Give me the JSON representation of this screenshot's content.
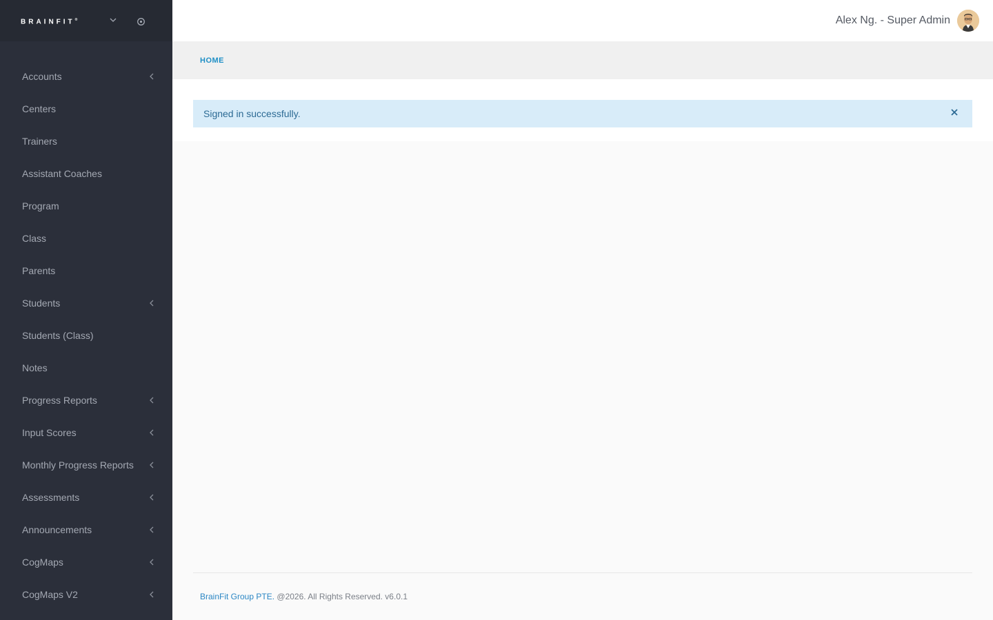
{
  "brand": {
    "logo_text": "BRAINFIT",
    "logo_mark": "®"
  },
  "sidebar": {
    "items": [
      {
        "label": "Accounts",
        "has_submenu": true
      },
      {
        "label": "Centers",
        "has_submenu": false
      },
      {
        "label": "Trainers",
        "has_submenu": false
      },
      {
        "label": "Assistant Coaches",
        "has_submenu": false
      },
      {
        "label": "Program",
        "has_submenu": false
      },
      {
        "label": "Class",
        "has_submenu": false
      },
      {
        "label": "Parents",
        "has_submenu": false
      },
      {
        "label": "Students",
        "has_submenu": true
      },
      {
        "label": "Students (Class)",
        "has_submenu": false
      },
      {
        "label": "Notes",
        "has_submenu": false
      },
      {
        "label": "Progress Reports",
        "has_submenu": true
      },
      {
        "label": "Input Scores",
        "has_submenu": true
      },
      {
        "label": "Monthly Progress Reports",
        "has_submenu": true
      },
      {
        "label": "Assessments",
        "has_submenu": true
      },
      {
        "label": "Announcements",
        "has_submenu": true
      },
      {
        "label": "CogMaps",
        "has_submenu": true
      },
      {
        "label": "CogMaps V2",
        "has_submenu": true
      }
    ]
  },
  "header": {
    "user_label": "Alex Ng. - Super Admin"
  },
  "breadcrumb": {
    "home": "HOME"
  },
  "alert": {
    "message": "Signed in successfully.",
    "close_glyph": "×"
  },
  "footer": {
    "company_link": "BrainFit Group PTE.",
    "rest": " @2026. All Rights Reserved. v6.0.1"
  },
  "colors": {
    "sidebar_bg": "#2b2f3a",
    "sidebar_brand_bg": "#262a33",
    "sidebar_text": "#a4a9b3",
    "accent": "#1e8fc6",
    "alert_bg": "#d8ecf9",
    "alert_text": "#2c6a94"
  }
}
